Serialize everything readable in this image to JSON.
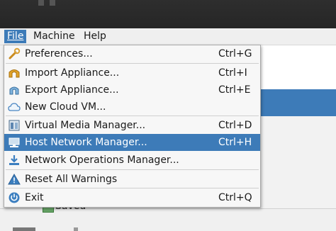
{
  "menubar": {
    "items": [
      {
        "label": "File",
        "active": true
      },
      {
        "label": "Machine",
        "active": false
      },
      {
        "label": "Help",
        "active": false
      }
    ]
  },
  "file_menu": {
    "items": [
      {
        "label": "Preferences...",
        "shortcut": "Ctrl+G",
        "icon": "wrench-icon"
      },
      {
        "label": "Import Appliance...",
        "shortcut": "Ctrl+I",
        "icon": "import-appliance-icon"
      },
      {
        "label": "Export Appliance...",
        "shortcut": "Ctrl+E",
        "icon": "export-appliance-icon"
      },
      {
        "label": "New Cloud VM...",
        "shortcut": "",
        "icon": "cloud-icon"
      },
      {
        "label": "Virtual Media Manager...",
        "shortcut": "Ctrl+D",
        "icon": "virtual-media-icon"
      },
      {
        "label": "Host Network Manager...",
        "shortcut": "Ctrl+H",
        "icon": "host-network-icon",
        "highlighted": true
      },
      {
        "label": "Network Operations Manager...",
        "shortcut": "",
        "icon": "download-icon"
      },
      {
        "label": "Reset All Warnings",
        "shortcut": "",
        "icon": "warning-icon"
      },
      {
        "label": "Exit",
        "shortcut": "Ctrl+Q",
        "icon": "power-icon"
      }
    ]
  },
  "background": {
    "vm_state": "Saved"
  },
  "colors": {
    "highlight": "#3d7bb8",
    "menu_bg": "#f7f7f7"
  }
}
